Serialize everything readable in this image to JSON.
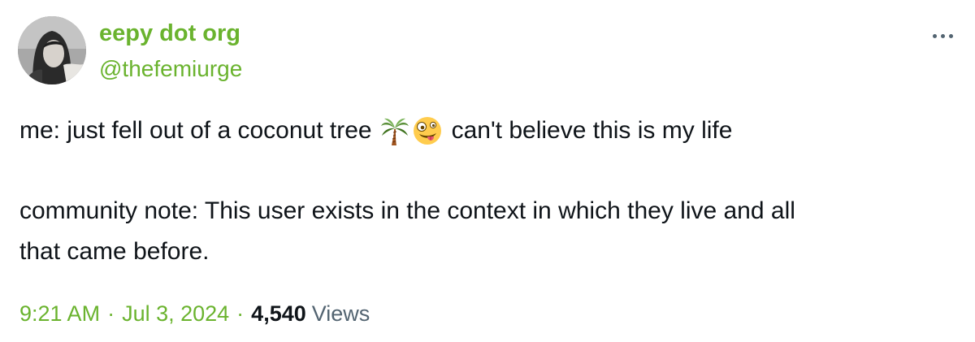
{
  "author": {
    "display_name": "eepy dot org",
    "handle": "@thefemiurge",
    "avatar_icon": "profile-photo"
  },
  "more_icon": "ellipsis-icon",
  "body": {
    "line1_before": "me: just fell out of a coconut tree",
    "emoji1": "palm-tree-emoji",
    "emoji2": "zany-face-emoji",
    "line1_after": "can't believe this is my life",
    "line3": "community note: This user exists in the context in which they live and all",
    "line4": "that came before."
  },
  "meta": {
    "time": "9:21 AM",
    "separator": "·",
    "date": "Jul 3, 2024",
    "view_count": "4,540",
    "views_label": "Views"
  },
  "colors": {
    "accent": "#6ab32e",
    "text": "#0f1419",
    "muted": "#536471"
  }
}
